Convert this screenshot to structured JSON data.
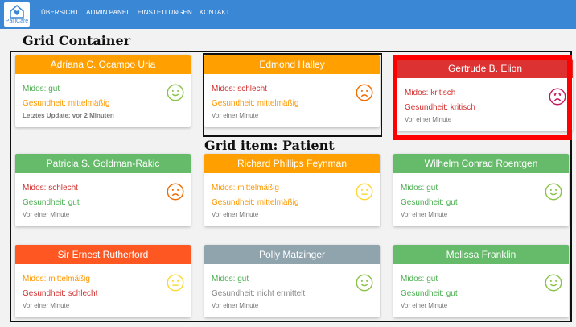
{
  "nav": {
    "logo_text": "PalliCare",
    "links": [
      "ÜBERSICHT",
      "ADMIN PANEL",
      "EINSTELLUNGEN",
      "KONTAKT"
    ]
  },
  "annotations": {
    "grid_container": "Grid Container",
    "grid_item": "Grid item: Patient"
  },
  "colors": {
    "navbar": "#3a87d6",
    "orange": "#ffa000",
    "red": "#dc3232",
    "green": "#66bb6a",
    "deep_orange": "#ff5722",
    "gray": "#90a4ae",
    "text_green": "#4caf50",
    "text_orange": "#ff9800",
    "text_red": "#d32f2f",
    "text_gray": "#888888"
  },
  "patients": [
    {
      "name": "Adriana C. Ocampo Uria",
      "header_color": "orange",
      "midos": "Midos: gut",
      "midos_color": "text_green",
      "gesundheit": "Gesundheit: mittelmäßig",
      "gesundheit_color": "text_orange",
      "update": "Letztes Update: vor 2 Minuten",
      "update_bold": true,
      "face": "happy",
      "face_color": "#8bc34a"
    },
    {
      "name": "Edmond Halley",
      "header_color": "orange",
      "midos": "Midos: schlecht",
      "midos_color": "text_red",
      "gesundheit": "Gesundheit: mittelmäßig",
      "gesundheit_color": "text_orange",
      "update": "Vor einer Minute",
      "update_bold": false,
      "face": "sad",
      "face_color": "#ef6c00"
    },
    {
      "name": "Gertrude B. Elion",
      "header_color": "red",
      "midos": "Midos: kritisch",
      "midos_color": "text_red",
      "gesundheit": "Gesundheit: kritisch",
      "gesundheit_color": "text_red",
      "update": "Vor einer Minute",
      "update_bold": false,
      "face": "very-sad",
      "face_color": "#c2185b"
    },
    {
      "name": "Patricia S. Goldman-Rakic",
      "header_color": "green",
      "midos": "Midos: schlecht",
      "midos_color": "text_red",
      "gesundheit": "Gesundheit: gut",
      "gesundheit_color": "text_green",
      "update": "Vor einer Minute",
      "update_bold": false,
      "face": "sad",
      "face_color": "#ef6c00"
    },
    {
      "name": "Richard Phillips Feynman",
      "header_color": "orange",
      "midos": "Midos: mittelmäßig",
      "midos_color": "text_orange",
      "gesundheit": "Gesundheit: mittelmäßig",
      "gesundheit_color": "text_orange",
      "update": "Vor einer Minute",
      "update_bold": false,
      "face": "neutral",
      "face_color": "#fdd835"
    },
    {
      "name": "Wilhelm Conrad Roentgen",
      "header_color": "green",
      "midos": "Midos: gut",
      "midos_color": "text_green",
      "gesundheit": "Gesundheit: gut",
      "gesundheit_color": "text_green",
      "update": "Vor einer Minute",
      "update_bold": false,
      "face": "happy",
      "face_color": "#8bc34a"
    },
    {
      "name": "Sir Ernest Rutherford",
      "header_color": "deep_orange",
      "midos": "Midos: mittelmäßig",
      "midos_color": "text_orange",
      "gesundheit": "Gesundheit: schlecht",
      "gesundheit_color": "text_red",
      "update": "Vor einer Minute",
      "update_bold": false,
      "face": "neutral",
      "face_color": "#fdd835"
    },
    {
      "name": "Polly Matzinger",
      "header_color": "gray",
      "midos": "Midos: gut",
      "midos_color": "text_green",
      "gesundheit": "Gesundheit: nicht ermittelt",
      "gesundheit_color": "text_gray",
      "update": "Vor einer Minute",
      "update_bold": false,
      "face": "happy",
      "face_color": "#8bc34a"
    },
    {
      "name": "Melissa Franklin",
      "header_color": "green",
      "midos": "Midos: gut",
      "midos_color": "text_green",
      "gesundheit": "Gesundheit: gut",
      "gesundheit_color": "text_green",
      "update": "Vor einer Minute",
      "update_bold": false,
      "face": "happy",
      "face_color": "#8bc34a"
    }
  ]
}
